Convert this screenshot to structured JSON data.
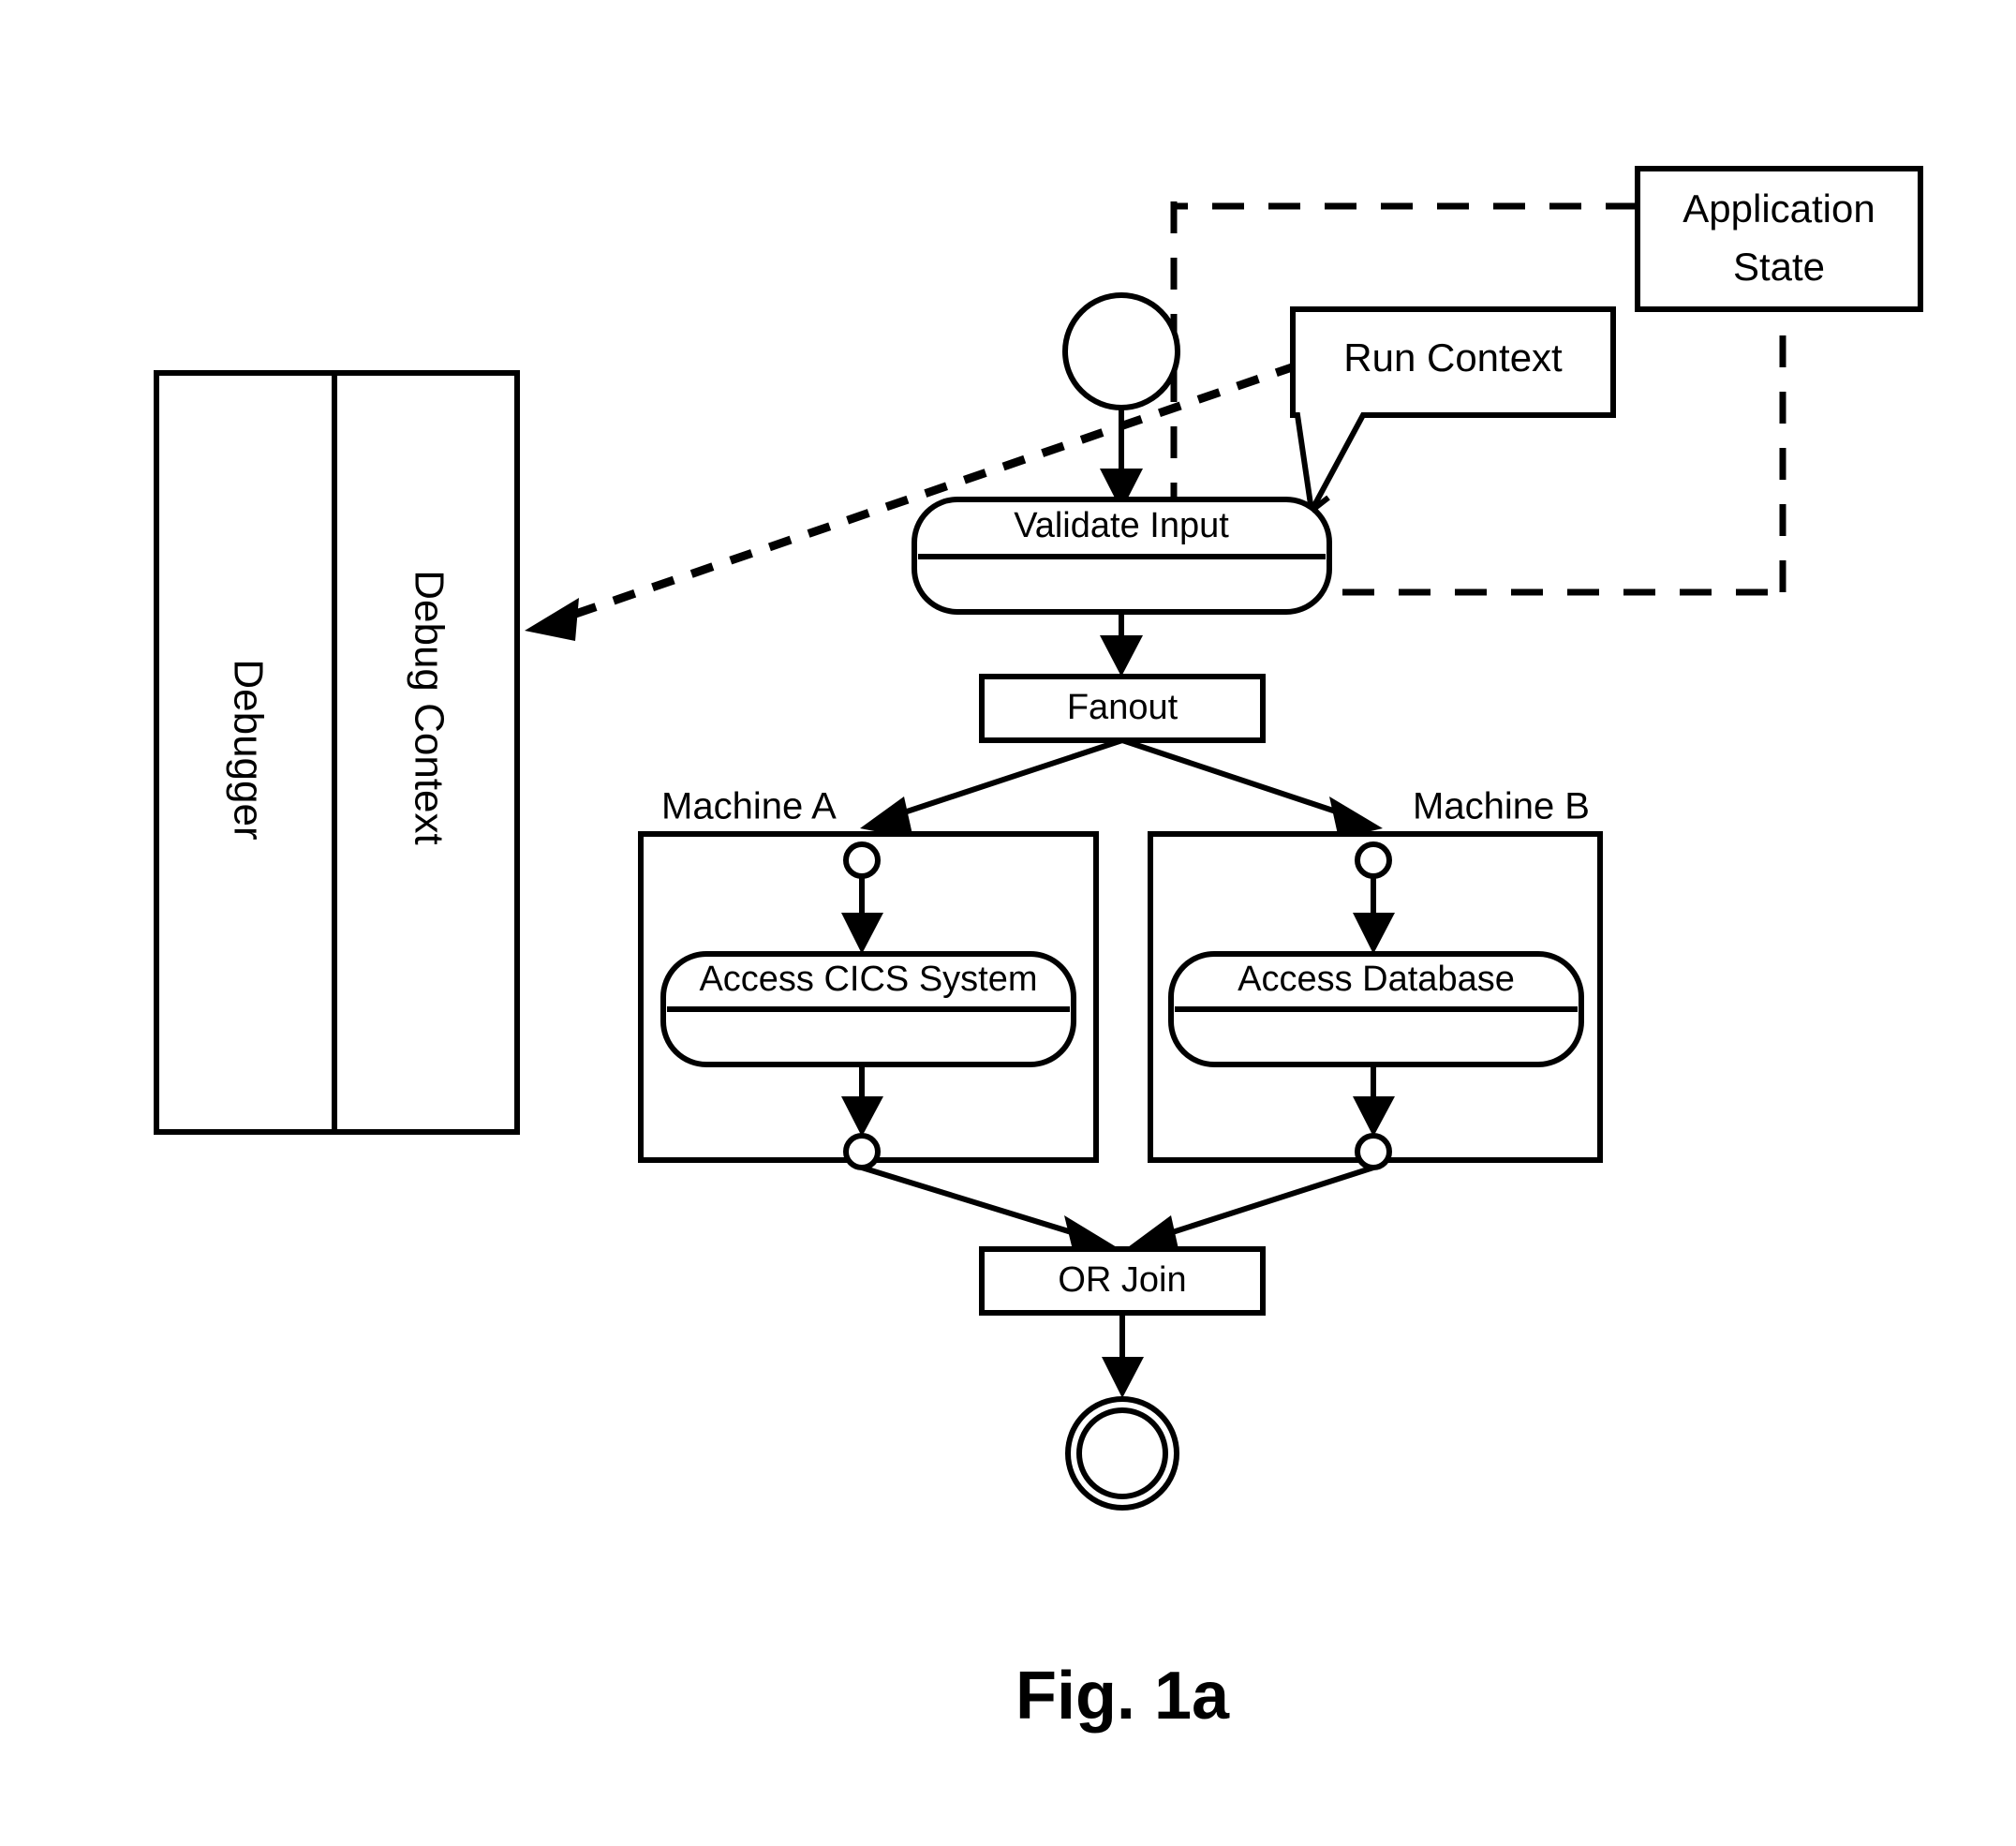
{
  "figure": {
    "caption": "Fig. 1a"
  },
  "debugger_panel": {
    "outer_label": "Debugger",
    "inner_label": "Debug Context"
  },
  "annotations": {
    "application_state": "Application State",
    "application_state_line1": "Application",
    "application_state_line2": "State",
    "run_context": "Run Context"
  },
  "swimlanes": [
    {
      "label": "Machine A"
    },
    {
      "label": "Machine B"
    }
  ],
  "flow": {
    "start_node": "initial-node",
    "end_node": "final-node",
    "activities": [
      {
        "label": "Validate Input"
      },
      {
        "label": "Access CICS System"
      },
      {
        "label": "Access Database"
      }
    ],
    "controls": [
      {
        "label": "Fanout"
      },
      {
        "label": "OR Join"
      }
    ]
  },
  "colors": {
    "stroke": "#000000",
    "background": "#ffffff"
  }
}
